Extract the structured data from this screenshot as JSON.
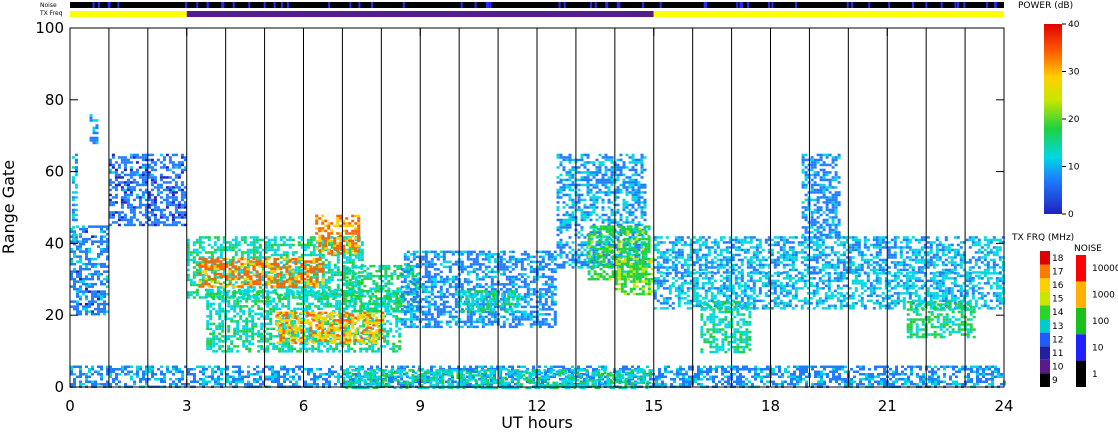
{
  "chart_data": {
    "type": "heatmap",
    "xlabel": "UT hours",
    "ylabel": "Range Gate",
    "x_ticks": [
      "0",
      "3",
      "6",
      "9",
      "12",
      "15",
      "18",
      "21",
      "24"
    ],
    "y_ticks": [
      "0",
      "20",
      "40",
      "60",
      "80",
      "100"
    ],
    "xlim": [
      0,
      24
    ],
    "ylim": [
      0,
      100
    ],
    "top_strips": {
      "noise_label": "Noise",
      "txfreq_label": "TX Freq",
      "txfreq_segments": [
        {
          "start": 0,
          "end": 3,
          "color": "#ffff00"
        },
        {
          "start": 3,
          "end": 15,
          "color": "#5a1a8c"
        },
        {
          "start": 15,
          "end": 24,
          "color": "#ffff00"
        }
      ]
    },
    "scan_boundaries_ut": [
      1,
      2,
      3,
      4,
      5,
      6,
      7,
      8,
      9,
      10,
      11,
      12,
      13,
      14,
      15,
      16,
      17,
      18,
      19,
      20,
      21,
      22,
      23
    ],
    "echo_regions": [
      {
        "x0": 0.05,
        "x1": 0.2,
        "y0": 40,
        "y1": 65,
        "power": 10
      },
      {
        "x0": 0.5,
        "x1": 0.7,
        "y0": 68,
        "y1": 76,
        "power": 9
      },
      {
        "x0": 1.0,
        "x1": 3.0,
        "y0": 45,
        "y1": 65,
        "power": 6
      },
      {
        "x0": 0.0,
        "x1": 1.0,
        "y0": 20,
        "y1": 45,
        "power": 7
      },
      {
        "x0": 3.0,
        "x1": 7.5,
        "y0": 25,
        "y1": 42,
        "power": 14
      },
      {
        "x0": 3.3,
        "x1": 6.5,
        "y0": 28,
        "y1": 36,
        "power": 33
      },
      {
        "x0": 6.3,
        "x1": 7.4,
        "y0": 37,
        "y1": 48,
        "power": 32
      },
      {
        "x0": 3.5,
        "x1": 8.5,
        "y0": 10,
        "y1": 27,
        "power": 14
      },
      {
        "x0": 5.3,
        "x1": 8.0,
        "y0": 12,
        "y1": 21,
        "power": 30
      },
      {
        "x0": 7.0,
        "x1": 9.0,
        "y0": 21,
        "y1": 34,
        "power": 16
      },
      {
        "x0": 8.5,
        "x1": 12.5,
        "y0": 17,
        "y1": 38,
        "power": 8
      },
      {
        "x0": 10.0,
        "x1": 11.5,
        "y0": 21,
        "y1": 27,
        "power": 14
      },
      {
        "x0": 12.5,
        "x1": 14.8,
        "y0": 33,
        "y1": 65,
        "power": 9
      },
      {
        "x0": 13.3,
        "x1": 14.9,
        "y0": 30,
        "y1": 45,
        "power": 18
      },
      {
        "x0": 14.0,
        "x1": 15.0,
        "y0": 26,
        "y1": 36,
        "power": 20
      },
      {
        "x0": 15.0,
        "x1": 24.0,
        "y0": 32,
        "y1": 42,
        "power": 10
      },
      {
        "x0": 15.0,
        "x1": 24.0,
        "y0": 22,
        "y1": 32,
        "power": 11
      },
      {
        "x0": 16.2,
        "x1": 17.5,
        "y0": 10,
        "y1": 24,
        "power": 14
      },
      {
        "x0": 21.5,
        "x1": 23.2,
        "y0": 14,
        "y1": 24,
        "power": 16
      },
      {
        "x0": 18.8,
        "x1": 19.8,
        "y0": 42,
        "y1": 65,
        "power": 8
      },
      {
        "x0": 0.0,
        "x1": 24.0,
        "y0": 0,
        "y1": 6,
        "power": 8
      },
      {
        "x0": 7.0,
        "x1": 15.0,
        "y0": 0,
        "y1": 5,
        "power": 14
      }
    ],
    "power_colorbar": {
      "title": "POWER (dB)",
      "ticks": [
        "0",
        "10",
        "20",
        "30",
        "40"
      ],
      "range": [
        0,
        40
      ]
    },
    "txfreq_colorbar": {
      "title": "TX FRQ (MHz)",
      "labels": [
        "9",
        "10",
        "11",
        "12",
        "13",
        "14",
        "15",
        "16",
        "17",
        "18"
      ],
      "colors": [
        "#000000",
        "#5a1a8c",
        "#2020a0",
        "#1e5cff",
        "#00cccc",
        "#2bd32b",
        "#c8e600",
        "#ffd000",
        "#ff7a00",
        "#e00000"
      ]
    },
    "noise_colorbar": {
      "title": "NOISE",
      "labels": [
        "1",
        "10",
        "100",
        "1000",
        "10000"
      ],
      "colors": [
        "#000000",
        "#2020ff",
        "#18c018",
        "#ffb000",
        "#ff0000"
      ]
    }
  }
}
